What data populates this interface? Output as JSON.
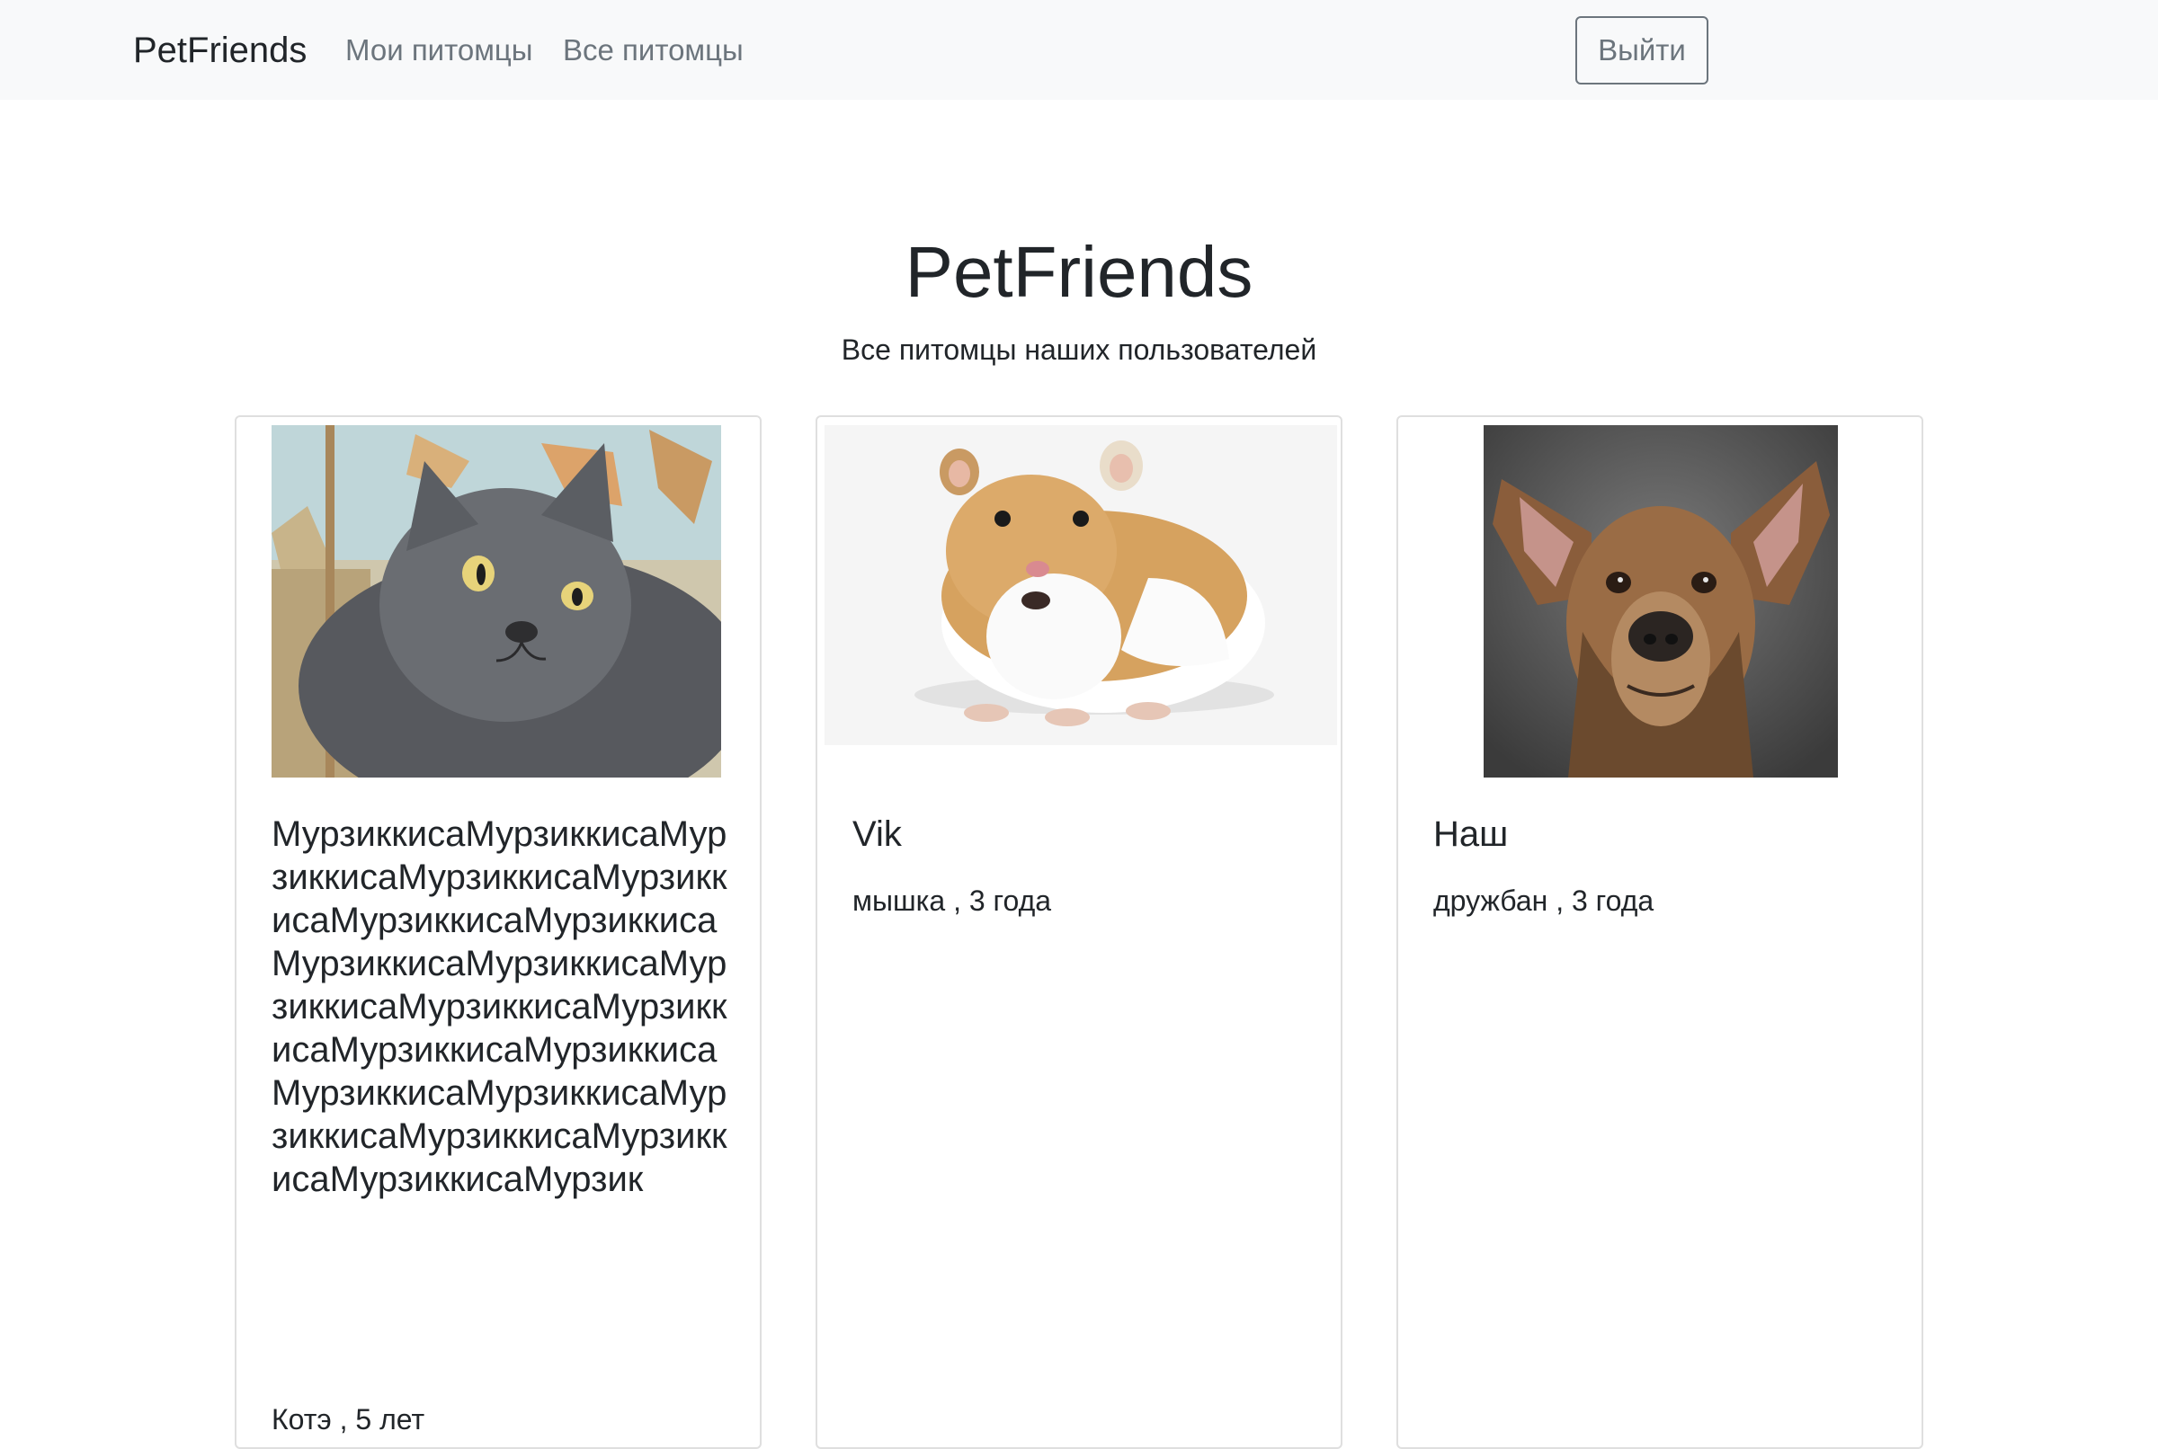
{
  "navbar": {
    "brand": "PetFriends",
    "links": [
      "Мои питомцы",
      "Все питомцы"
    ],
    "logout_label": "Выйти"
  },
  "hero": {
    "title": "PetFriends",
    "subtitle": "Все питомцы наших пользователей"
  },
  "pets": [
    {
      "name": "МурзиккисаМурзиккисаМурзиккисаМурзиккисаМурзиккисаМурзиккисаМурзиккисаМурзиккисаМурзиккисаМурзиккисаМурзиккисаМурзиккисаМурзиккисаМурзиккисаМурзиккисаМурзиккисаМурзиккисаМурзиккисаМурзиккисаМурзиккисаМурзик",
      "breed": "Котэ",
      "age": "5 лет",
      "info": "Котэ , 5 лет",
      "photo_icon": "cat-photo"
    },
    {
      "name": "Vik",
      "breed": "мышка",
      "age": "3 года",
      "info": "мышка , 3 года",
      "photo_icon": "hamster-photo"
    },
    {
      "name": "Наш",
      "breed": "дружбан",
      "age": "3 года",
      "info": "дружбан , 3 года",
      "photo_icon": "dog-photo"
    }
  ]
}
